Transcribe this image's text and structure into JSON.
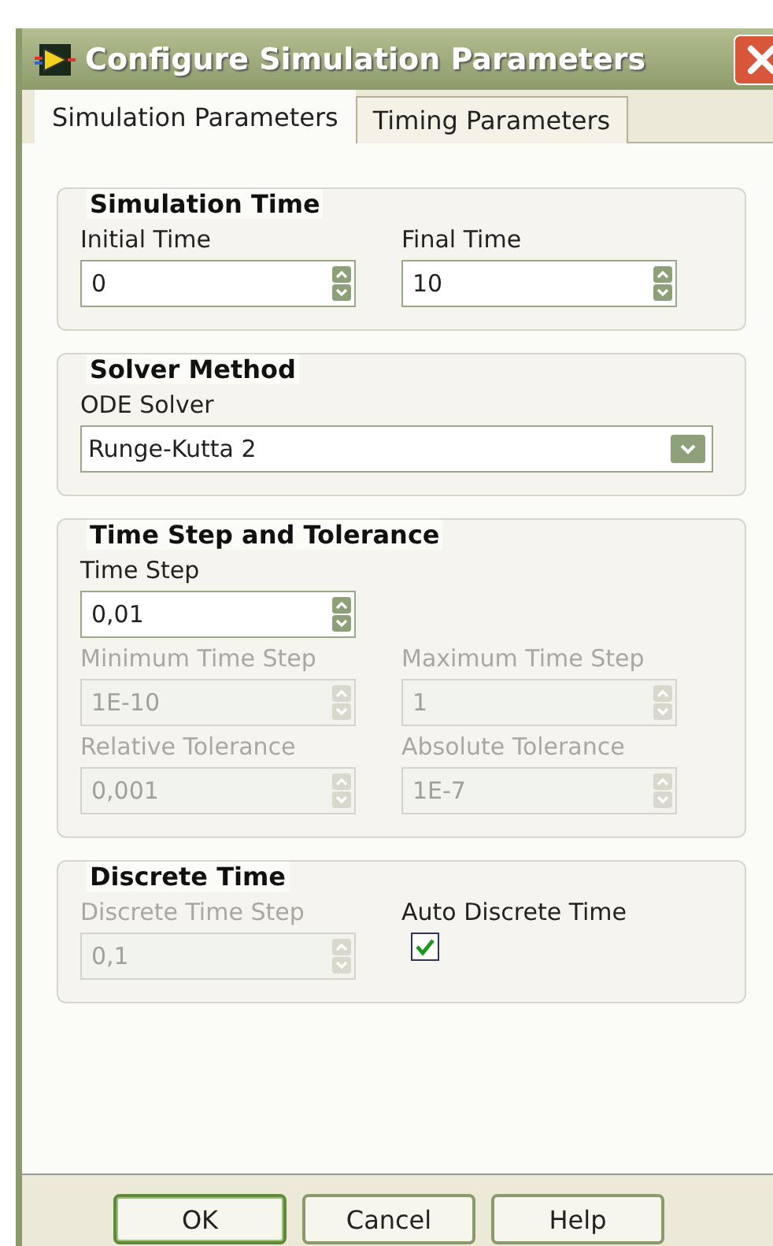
{
  "window": {
    "title": "Configure Simulation Parameters"
  },
  "tabs": [
    {
      "label": "Simulation Parameters",
      "selected": true
    },
    {
      "label": "Timing Parameters",
      "selected": false
    }
  ],
  "groups": [
    {
      "title": "Simulation Time",
      "rows": [
        [
          {
            "kind": "numeric",
            "label": "Initial Time",
            "value": "0",
            "disabled": false
          },
          {
            "kind": "numeric",
            "label": "Final Time",
            "value": "10",
            "disabled": false
          }
        ]
      ]
    },
    {
      "title": "Solver Method",
      "rows": [
        [
          {
            "kind": "dropdown",
            "label": "ODE Solver",
            "value": "Runge-Kutta 2",
            "disabled": false
          }
        ]
      ]
    },
    {
      "title": "Time Step and Tolerance",
      "rows": [
        [
          {
            "kind": "numeric",
            "label": "Time Step",
            "value": "0,01",
            "disabled": false
          }
        ],
        [
          {
            "kind": "numeric",
            "label": "Minimum Time Step",
            "value": "1E-10",
            "disabled": true
          },
          {
            "kind": "numeric",
            "label": "Maximum Time Step",
            "value": "1",
            "disabled": true
          }
        ],
        [
          {
            "kind": "numeric",
            "label": "Relative Tolerance",
            "value": "0,001",
            "disabled": true
          },
          {
            "kind": "numeric",
            "label": "Absolute Tolerance",
            "value": "1E-7",
            "disabled": true
          }
        ]
      ]
    },
    {
      "title": "Discrete Time",
      "rows": [
        [
          {
            "kind": "numeric",
            "label": "Discrete Time Step",
            "value": "0,1",
            "disabled": true
          },
          {
            "kind": "checkbox",
            "label": "Auto Discrete Time",
            "checked": true,
            "disabled": false
          }
        ]
      ]
    }
  ],
  "buttons": [
    {
      "label": "OK",
      "default": true
    },
    {
      "label": "Cancel",
      "default": false
    },
    {
      "label": "Help",
      "default": false
    }
  ]
}
